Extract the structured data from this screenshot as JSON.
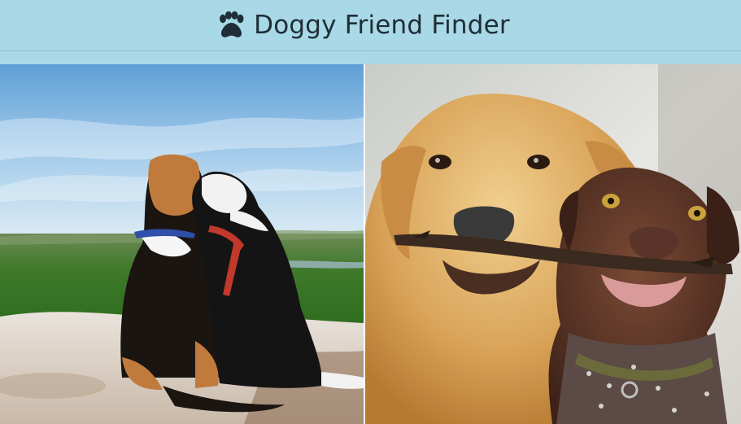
{
  "header": {
    "title": "Doggy Friend Finder",
    "icon": "paw-icon",
    "background_color": "#a9d8e6",
    "text_color": "#1f2d36"
  },
  "gallery": {
    "photos": [
      {
        "name": "dogs-hugging-on-cliff-photo"
      },
      {
        "name": "dogs-sharing-stick-photo"
      }
    ]
  }
}
